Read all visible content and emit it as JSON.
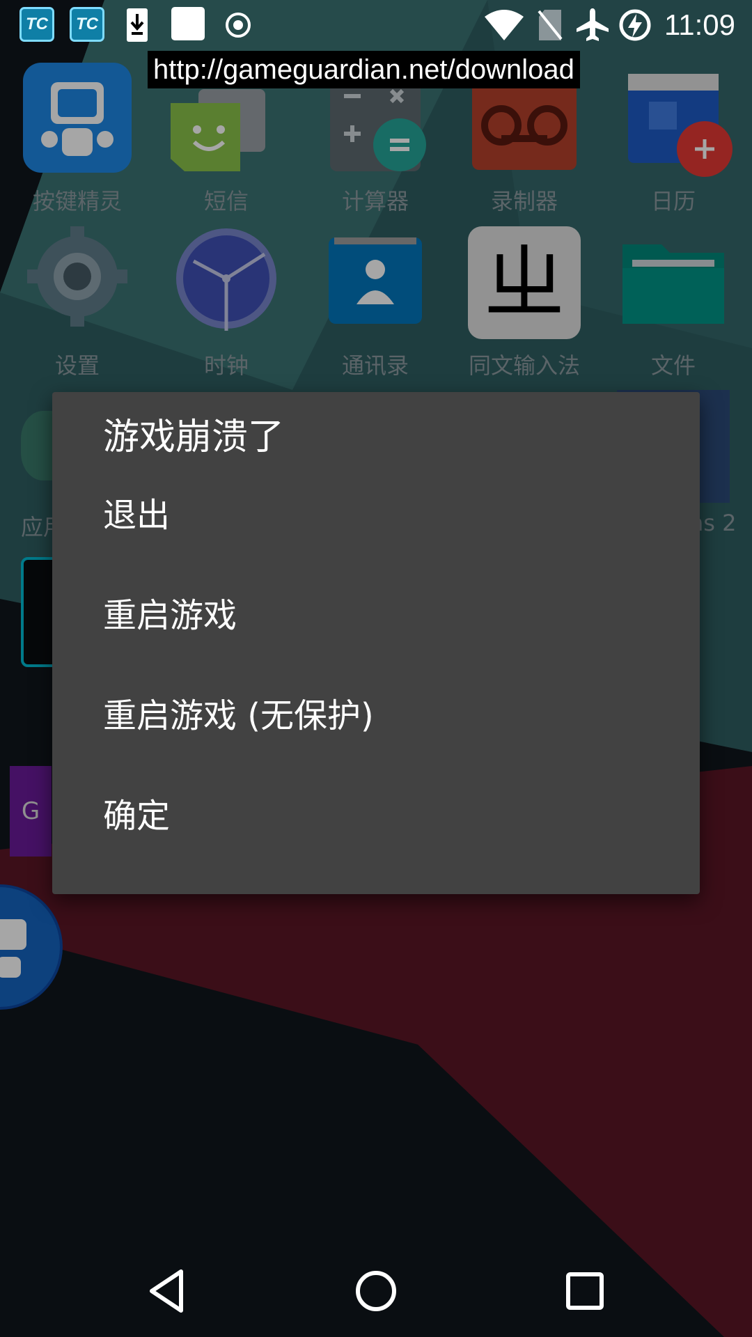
{
  "status_bar": {
    "left_icons": [
      "tc-app-icon",
      "tc-app-icon",
      "download-icon",
      "square-icon",
      "record-icon"
    ],
    "tc_text": "TC",
    "right_icons": [
      "wifi-icon",
      "no-sim-icon",
      "airplane-icon",
      "battery-charging-icon"
    ],
    "time": "11:09"
  },
  "toast": {
    "url": "http://gameguardian.net/download"
  },
  "launcher": {
    "row1": [
      {
        "label": "按键精灵",
        "icon": "robot-icon"
      },
      {
        "label": "短信",
        "icon": "messaging-icon"
      },
      {
        "label": "计算器",
        "icon": "calculator-icon"
      },
      {
        "label": "录制器",
        "icon": "recorder-icon"
      },
      {
        "label": "日历",
        "icon": "calendar-icon"
      }
    ],
    "row2": [
      {
        "label": "设置",
        "icon": "settings-gear-icon"
      },
      {
        "label": "时钟",
        "icon": "clock-icon"
      },
      {
        "label": "通讯录",
        "icon": "contacts-icon"
      },
      {
        "label": "同文输入法",
        "icon": "ime-icon",
        "glyph": "ㄓ"
      },
      {
        "label": "文件",
        "icon": "folder-icon"
      }
    ],
    "partial_labels": {
      "left": "应用",
      "right": "ns 2"
    },
    "gg_letter": "G"
  },
  "dialog": {
    "title": "游戏崩溃了",
    "items": [
      "退出",
      "重启游戏",
      "重启游戏 (无保护)",
      "确定"
    ]
  },
  "nav_bar": {
    "buttons": [
      "back-icon",
      "home-icon",
      "recents-icon"
    ]
  },
  "colors": {
    "dialog_bg": "#424242",
    "text": "#ffffff",
    "wall_red": "#5a1624",
    "wall_teal": "#2f5f62"
  }
}
